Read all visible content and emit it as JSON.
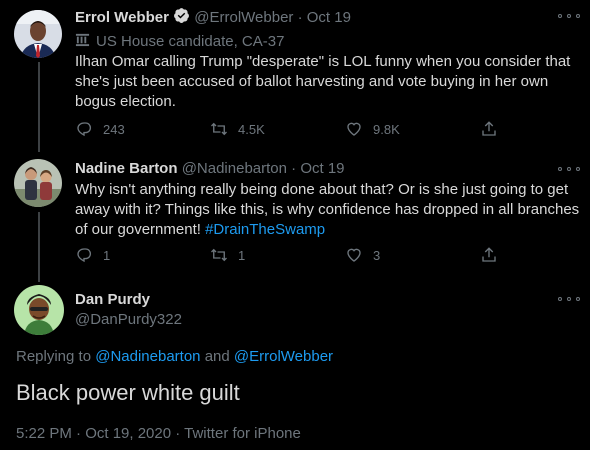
{
  "tweets": [
    {
      "name": "Errol Webber",
      "handle": "@ErrolWebber",
      "separator": "·",
      "date": "Oct 19",
      "label": "US House candidate, CA-37",
      "text": "Ilhan Omar calling Trump \"desperate\" is LOL funny when you consider that she's just been accused of ballot harvesting and vote buying in her own bogus election.",
      "replies": "243",
      "retweets": "4.5K",
      "likes": "9.8K"
    },
    {
      "name": "Nadine Barton",
      "handle": "@Nadinebarton",
      "separator": "·",
      "date": "Oct 19",
      "text": "Why isn't anything really being done about that? Or is she just going to get away with it? Things like this, is why confidence has dropped in all branches of our government!",
      "hashtag": "#DrainTheSwamp",
      "replies": "1",
      "retweets": "1",
      "likes": "3"
    }
  ],
  "main_tweet": {
    "name": "Dan Purdy",
    "handle": "@DanPurdy322",
    "replying_prefix": "Replying to",
    "replying_user1": "@Nadinebarton",
    "replying_and": "and",
    "replying_user2": "@ErrolWebber",
    "text": "Black power white guilt",
    "meta": "5:22 PM · Oct 19, 2020 · Twitter for iPhone"
  },
  "colors": {
    "background": "#000000",
    "accent": "#1d9bf0",
    "muted": "#6e767d",
    "text": "#d9d9d9"
  },
  "icons": [
    "verified-badge-icon",
    "government-building-icon",
    "reply-icon",
    "retweet-icon",
    "like-icon",
    "share-icon",
    "more-options-icon"
  ]
}
